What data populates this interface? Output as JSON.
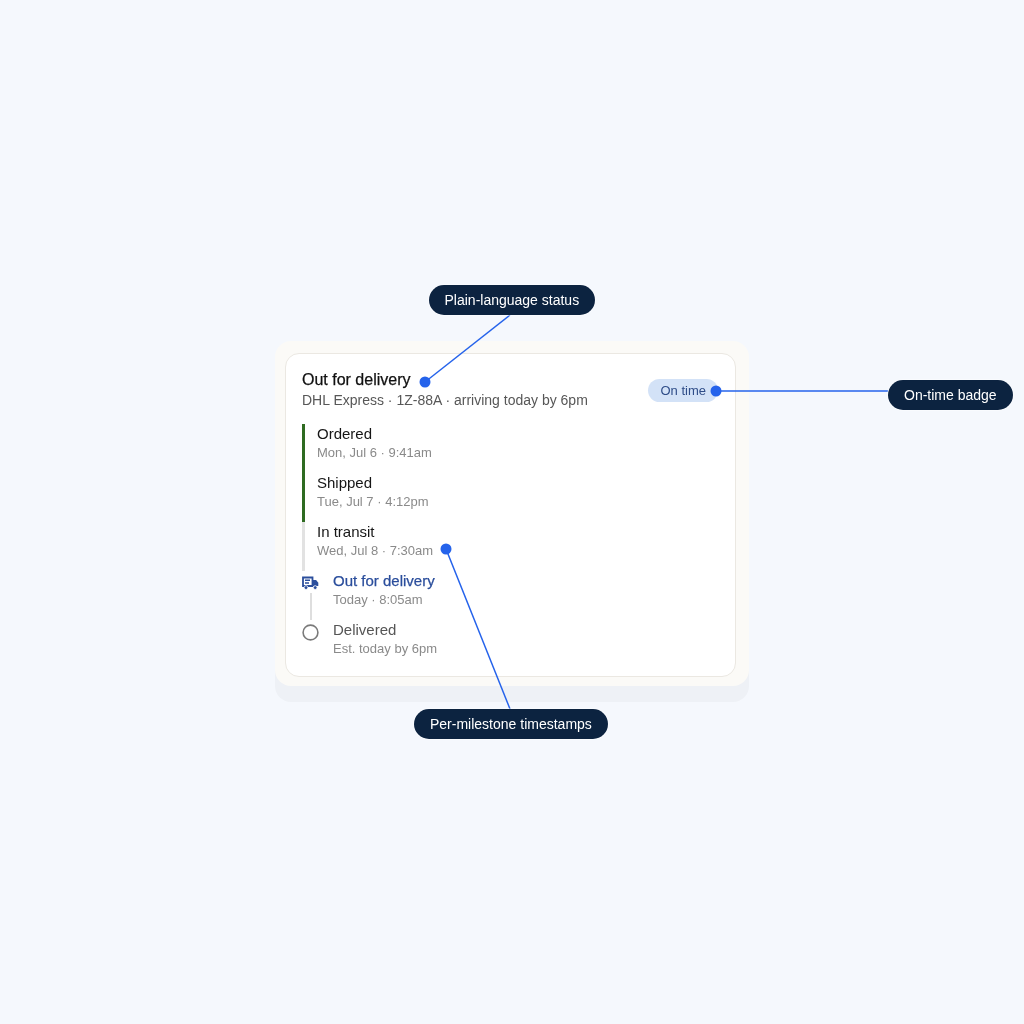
{
  "card": {
    "title": "Out for delivery",
    "subtitle": "DHL Express · 1Z-88A · arriving today by 6pm",
    "badge": "On time"
  },
  "milestones": [
    {
      "kind": "complete",
      "name": "Ordered",
      "time": "Mon, Jul 6 · 9:41am"
    },
    {
      "kind": "complete",
      "name": "Shipped",
      "time": "Tue, Jul 7 · 4:12pm"
    },
    {
      "kind": "plain",
      "name": "In transit",
      "time": "Wed, Jul 8 · 7:30am"
    },
    {
      "kind": "active",
      "name": "Out for delivery",
      "time": "Today · 8:05am"
    },
    {
      "kind": "upcoming",
      "name": "Delivered",
      "time": "Est. today by 6pm"
    }
  ],
  "annotations": [
    {
      "label": "Plain-language status"
    },
    {
      "label": "On-time badge"
    },
    {
      "label": "Per-milestone timestamps"
    }
  ]
}
